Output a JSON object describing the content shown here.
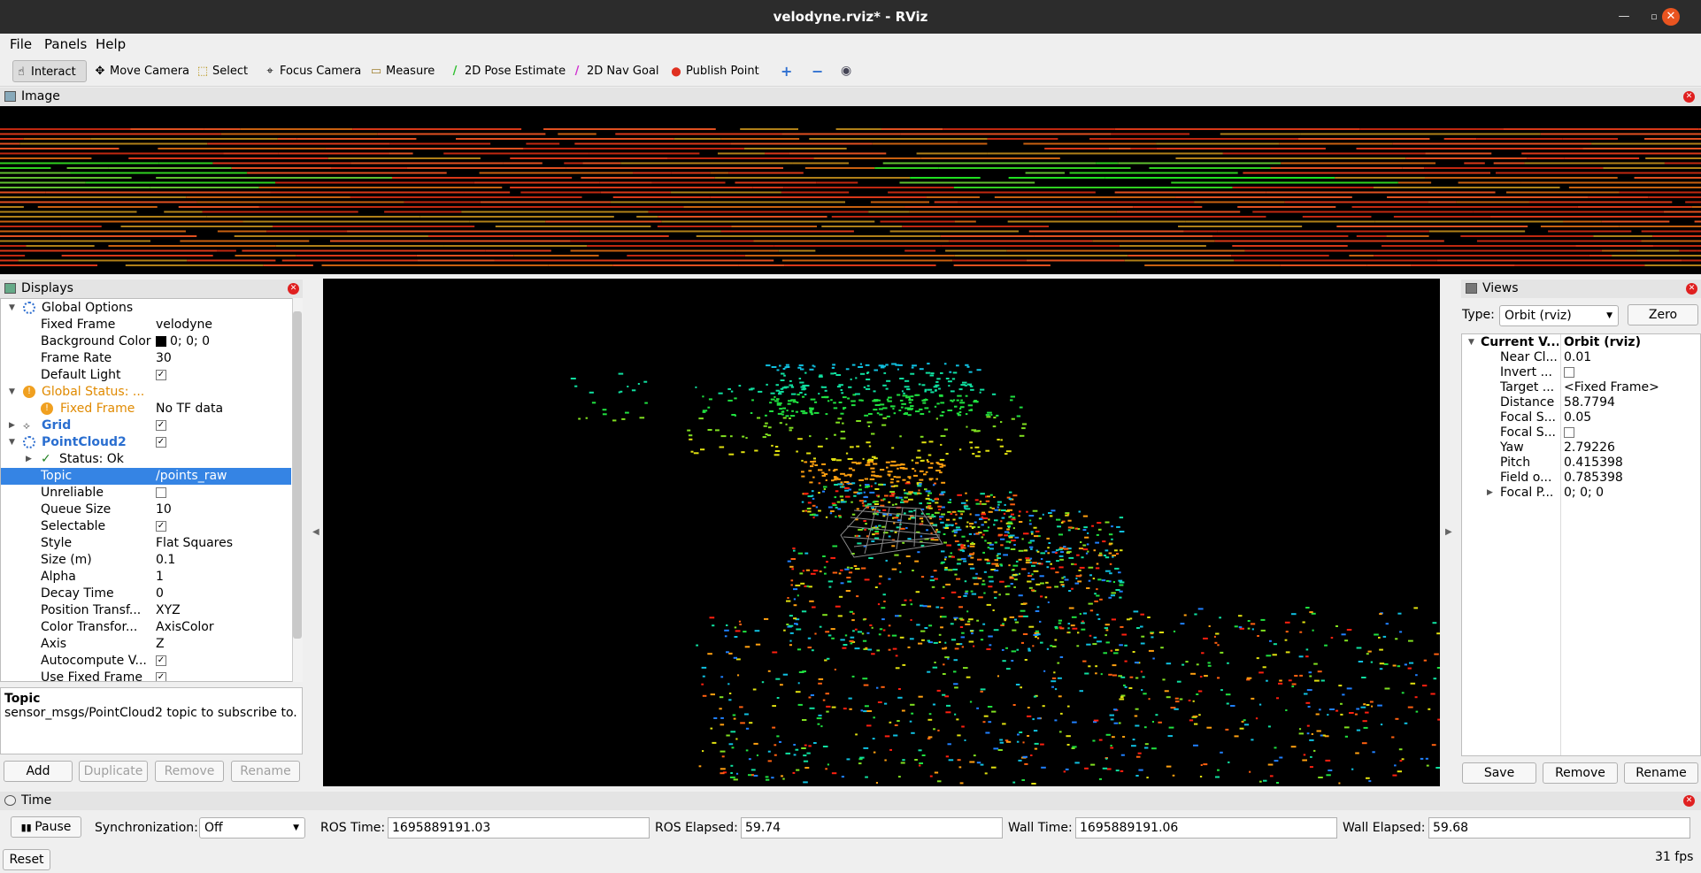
{
  "window": {
    "title": "velodyne.rviz* - RViz"
  },
  "menu": [
    "File",
    "Panels",
    "Help"
  ],
  "toolbar": {
    "tools": [
      {
        "label": "Interact",
        "icon": "hand-icon",
        "glyph": "☝"
      },
      {
        "label": "Move Camera",
        "icon": "move-camera-icon",
        "glyph": "✥"
      },
      {
        "label": "Select",
        "icon": "select-icon",
        "glyph": "⬚"
      },
      {
        "label": "Focus Camera",
        "icon": "focus-camera-icon",
        "glyph": "⌖"
      },
      {
        "label": "Measure",
        "icon": "measure-icon",
        "glyph": "▭"
      },
      {
        "label": "2D Pose Estimate",
        "icon": "pose-arrow-icon",
        "glyph": "/"
      },
      {
        "label": "2D Nav Goal",
        "icon": "nav-goal-arrow-icon",
        "glyph": "/"
      },
      {
        "label": "Publish Point",
        "icon": "map-pin-icon",
        "glyph": "⬤"
      }
    ],
    "colors": {
      "pose": "#30c030",
      "nav": "#d030d0",
      "pin": "#e03020"
    }
  },
  "image_panel": {
    "title": "Image"
  },
  "displays": {
    "title": "Displays",
    "rows": [
      {
        "key": "Global Options",
        "value": ""
      },
      {
        "key": "Fixed Frame",
        "value": "velodyne"
      },
      {
        "key": "Background Color",
        "value": "0; 0; 0"
      },
      {
        "key": "Frame Rate",
        "value": "30"
      },
      {
        "key": "Default Light",
        "value": "✓"
      },
      {
        "key": "Global Status: ...",
        "value": ""
      },
      {
        "key": "Fixed Frame",
        "value": "No TF data"
      },
      {
        "key": "Grid",
        "value": "✓"
      },
      {
        "key": "PointCloud2",
        "value": "✓"
      },
      {
        "key": "Status: Ok",
        "value": ""
      },
      {
        "key": "Topic",
        "value": "/points_raw"
      },
      {
        "key": "Unreliable",
        "value": ""
      },
      {
        "key": "Queue Size",
        "value": "10"
      },
      {
        "key": "Selectable",
        "value": "✓"
      },
      {
        "key": "Style",
        "value": "Flat Squares"
      },
      {
        "key": "Size (m)",
        "value": "0.1"
      },
      {
        "key": "Alpha",
        "value": "1"
      },
      {
        "key": "Decay Time",
        "value": "0"
      },
      {
        "key": "Position Transf...",
        "value": "XYZ"
      },
      {
        "key": "Color Transfor...",
        "value": "AxisColor"
      },
      {
        "key": "Axis",
        "value": "Z"
      },
      {
        "key": "Autocompute V...",
        "value": "✓"
      },
      {
        "key": "Use Fixed Frame",
        "value": "✓"
      }
    ],
    "description": {
      "title": "Topic",
      "text": "sensor_msgs/PointCloud2 topic to subscribe to."
    },
    "buttons": [
      "Add",
      "Duplicate",
      "Remove",
      "Rename"
    ]
  },
  "views": {
    "title": "Views",
    "type_label": "Type:",
    "type_value": "Orbit (rviz)",
    "zero_label": "Zero",
    "header": {
      "key": "Current V...",
      "value": "Orbit (rviz)"
    },
    "rows": [
      {
        "key": "Near Cl...",
        "value": "0.01"
      },
      {
        "key": "Invert ...",
        "value": ""
      },
      {
        "key": "Target ...",
        "value": "<Fixed Frame>"
      },
      {
        "key": "Distance",
        "value": "58.7794"
      },
      {
        "key": "Focal S...",
        "value": "0.05"
      },
      {
        "key": "Focal S...",
        "value": ""
      },
      {
        "key": "Yaw",
        "value": "2.79226"
      },
      {
        "key": "Pitch",
        "value": "0.415398"
      },
      {
        "key": "Field o...",
        "value": "0.785398"
      },
      {
        "key": "Focal P...",
        "value": "0; 0; 0"
      }
    ],
    "buttons": [
      "Save",
      "Remove",
      "Rename"
    ]
  },
  "time": {
    "title": "Time",
    "pause_label": "Pause",
    "sync_label": "Synchronization:",
    "sync_value": "Off",
    "ros_time_label": "ROS Time:",
    "ros_time": "1695889191.03",
    "ros_elapsed_label": "ROS Elapsed:",
    "ros_elapsed": "59.74",
    "wall_time_label": "Wall Time:",
    "wall_time": "1695889191.06",
    "wall_elapsed_label": "Wall Elapsed:",
    "wall_elapsed": "59.68",
    "reset_label": "Reset",
    "fps": "31 fps"
  }
}
